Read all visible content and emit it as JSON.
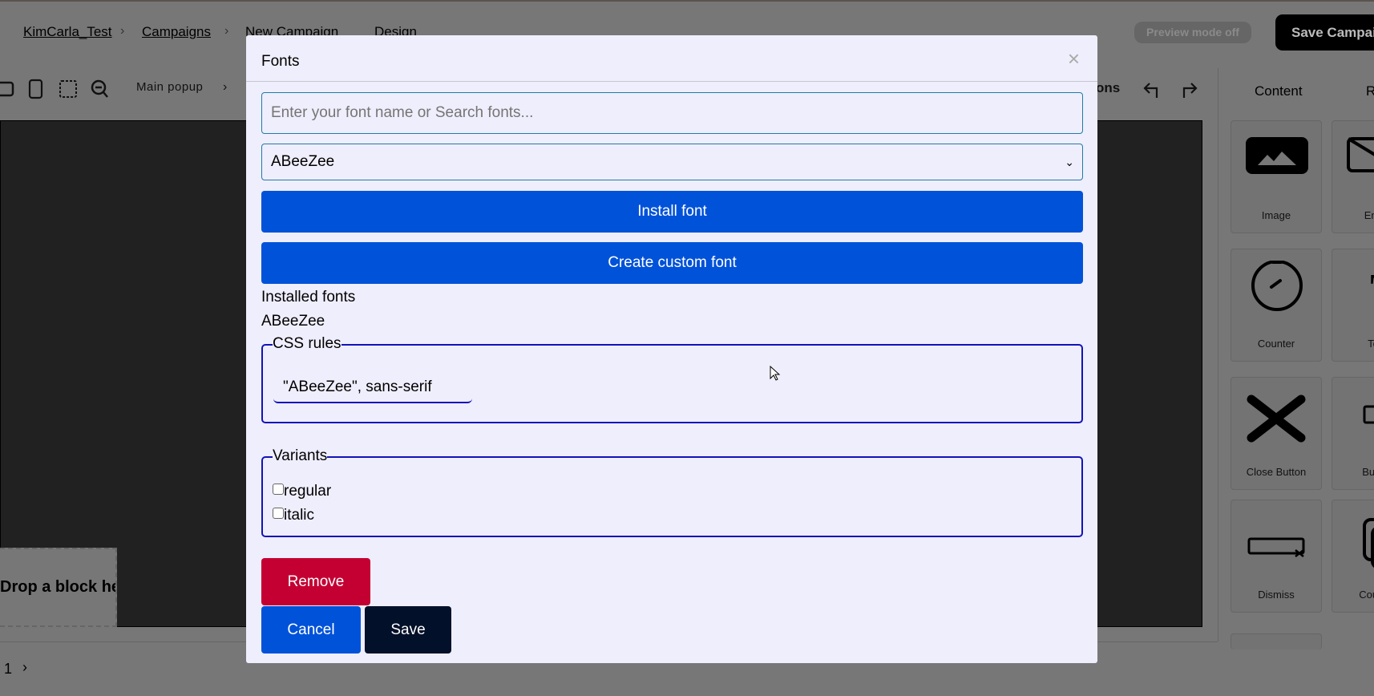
{
  "breadcrumb": {
    "items": [
      "KimCarla_Test",
      "Campaigns",
      "New Campaign",
      "Design"
    ]
  },
  "header": {
    "preview_label": "Preview mode off",
    "save_campaign_label": "Save Campaign"
  },
  "toolbar": {
    "layer_label": "Main popup",
    "options_label": "Options"
  },
  "right_panel": {
    "tabs": [
      "Content",
      "R"
    ],
    "blocks": [
      "Image",
      "Email",
      "Counter",
      "Text",
      "Close Button",
      "Button",
      "Dismiss",
      "Coupon"
    ]
  },
  "canvas": {
    "drop_label": "Drop a block here"
  },
  "pagination": {
    "page": "1"
  },
  "modal": {
    "title": "Fonts",
    "search_placeholder": "Enter your font name or Search fonts...",
    "select_value": "ABeeZee",
    "install_label": "Install font",
    "create_label": "Create custom font",
    "installed_heading": "Installed fonts",
    "installed_font": "ABeeZee",
    "css_legend": "CSS rules",
    "css_value": "\"ABeeZee\", sans-serif",
    "variants_legend": "Variants",
    "variants": [
      {
        "label": "regular",
        "checked": false
      },
      {
        "label": "italic",
        "checked": false
      }
    ],
    "remove_label": "Remove",
    "cancel_label": "Cancel",
    "save_label": "Save"
  },
  "colors": {
    "primary": "#0052d9",
    "danger": "#c40032",
    "dark": "#021029",
    "fieldset": "#1313b8"
  }
}
